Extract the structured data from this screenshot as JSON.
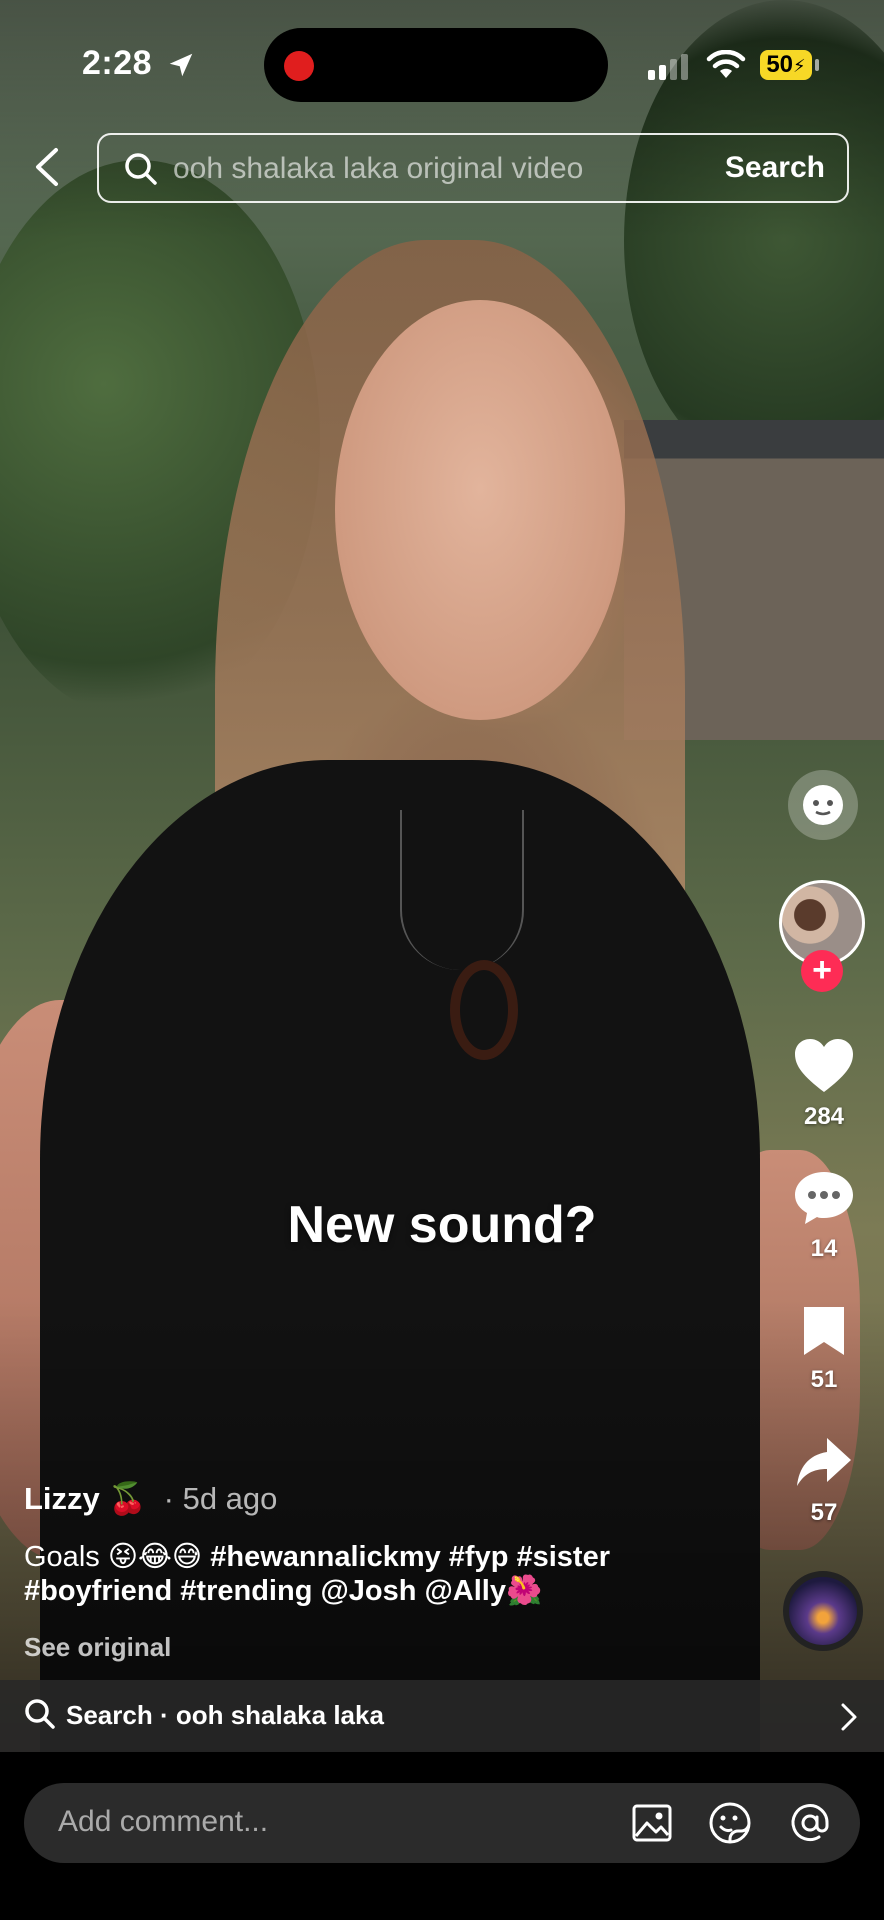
{
  "status_bar": {
    "time": "2:28",
    "battery": "50"
  },
  "search": {
    "query": "ooh shalaka laka original video",
    "button": "Search"
  },
  "overlay_caption": "New sound?",
  "rail": {
    "likes": "284",
    "comments": "14",
    "saves": "51",
    "shares": "57",
    "follow_symbol": "+"
  },
  "post": {
    "username": "Lizzy 🍒",
    "time_ago": "· 5d ago",
    "desc_prefix": "Goals 😝😂😅 ",
    "desc_tags": "#hewannalickmy #fyp #sister #boyfriend #trending @Josh @Ally🌺",
    "see_original": "See original"
  },
  "related_search": {
    "label": "Search · ooh shalaka laka"
  },
  "comment": {
    "placeholder": "Add comment..."
  },
  "colors": {
    "follow": "#fe2c55",
    "battery": "#f7d826",
    "record": "#e01e1e"
  }
}
